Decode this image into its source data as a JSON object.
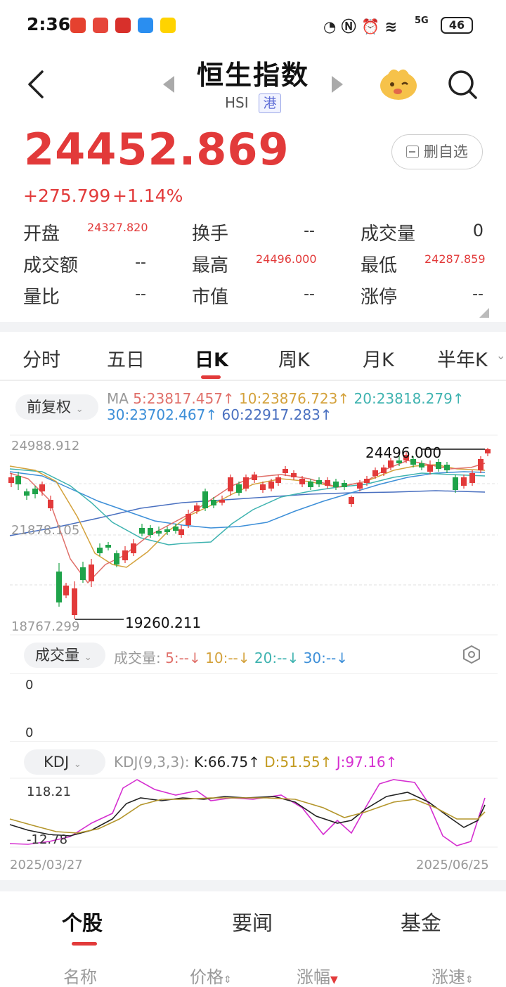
{
  "status_bar": {
    "time": "2:36",
    "battery": "46",
    "network": "5G"
  },
  "header": {
    "title": "恒生指数",
    "code": "HSI",
    "market_badge": "港"
  },
  "quote": {
    "price": "24452.869",
    "change": "+275.799",
    "change_pct": "+1.14%",
    "fav_button": "删自选",
    "stats": [
      {
        "label": "开盘",
        "value": "24327.820"
      },
      {
        "label": "换手",
        "value": "--"
      },
      {
        "label": "成交量",
        "value": "0"
      },
      {
        "label": "成交额",
        "value": "--"
      },
      {
        "label": "最高",
        "value": "24496.000"
      },
      {
        "label": "最低",
        "value": "24287.859"
      },
      {
        "label": "量比",
        "value": "--"
      },
      {
        "label": "市值",
        "value": "--"
      },
      {
        "label": "涨停",
        "value": "--"
      }
    ]
  },
  "period_tabs": [
    "分时",
    "五日",
    "日K",
    "周K",
    "月K",
    "半年K"
  ],
  "active_period": "日K",
  "chart_controls": {
    "adjust": "前复权",
    "ma_prefix": "MA",
    "ma": [
      {
        "label": "5:23817.457↑",
        "color": "#e0706a"
      },
      {
        "label": "10:23876.723↑",
        "color": "#d4a23c"
      },
      {
        "label": "20:23818.279↑",
        "color": "#3fb3b0"
      },
      {
        "label": "30:23702.467↑",
        "color": "#3d8fd8"
      },
      {
        "label": "60:22917.283↑",
        "color": "#4a70c0"
      }
    ],
    "y_top": "24988.912",
    "y_mid": "21878.105",
    "y_bot": "18767.299",
    "max_marker": "24496.000",
    "min_marker": "19260.211",
    "volume_pill": "成交量",
    "volume_prefix": "成交量:",
    "volume_ma": [
      {
        "label": "5:--↓",
        "color": "#e0706a"
      },
      {
        "label": "10:--↓",
        "color": "#d4a23c"
      },
      {
        "label": "20:--↓",
        "color": "#3fb3b0"
      },
      {
        "label": "30:--↓",
        "color": "#3d8fd8"
      }
    ],
    "vol_top": "0",
    "vol_bot": "0",
    "kdj_pill": "KDJ",
    "kdj_prefix": "KDJ(9,3,3):",
    "kdj": [
      {
        "label": "K:66.75↑",
        "color": "#222222"
      },
      {
        "label": "D:51.55↑",
        "color": "#c29a1e"
      },
      {
        "label": "J:97.16↑",
        "color": "#d52fd0"
      }
    ],
    "kdj_top": "118.21",
    "kdj_bot": "-12.78",
    "date_start": "2025/03/27",
    "date_end": "2025/06/25"
  },
  "chart_data": {
    "type": "candlestick",
    "x_range": [
      "2025/03/27",
      "2025/06/25"
    ],
    "ylim": [
      18767.299,
      24988.912
    ],
    "high_marker": 24496.0,
    "low_marker": 19260.211,
    "colors": {
      "up": "#e23a3a",
      "down": "#1fa34a"
    }
  },
  "bottom_tabs": [
    "个股",
    "要闻",
    "基金"
  ],
  "columns": [
    "名称",
    "价格",
    "涨幅",
    "涨速"
  ]
}
